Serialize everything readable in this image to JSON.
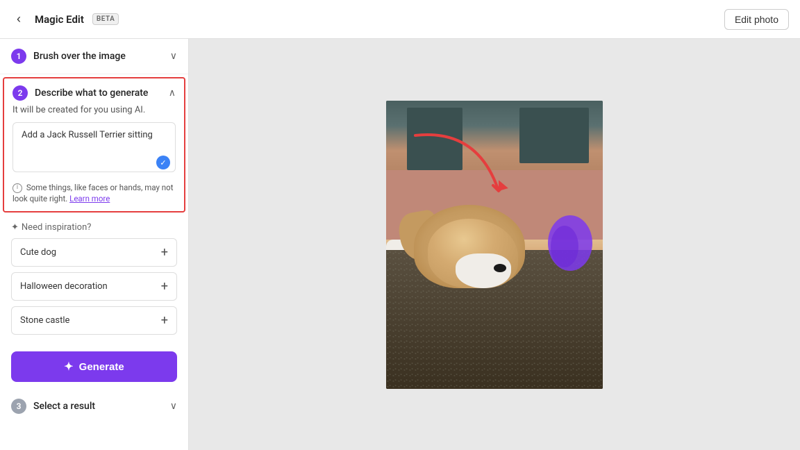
{
  "header": {
    "back_label": "‹",
    "title": "Magic Edit",
    "beta_label": "BETA",
    "edit_photo_btn": "Edit photo"
  },
  "sidebar": {
    "step1": {
      "number": "1",
      "label": "Brush over the image",
      "chevron": "∨"
    },
    "step2": {
      "number": "2",
      "label": "Describe what to generate",
      "subtitle": "It will be created for you using AI.",
      "prompt_value": "Add a Jack Russell Terrier sitting",
      "prompt_placeholder": "Add a Jack Russell Terrier sitting",
      "warning_main": "Some things, like faces or hands, may not look quite right.",
      "warning_link": "Learn more",
      "chevron": "∧"
    },
    "inspiration": {
      "label": "Need inspiration?",
      "suggestions": [
        {
          "label": "Cute dog"
        },
        {
          "label": "Halloween decoration"
        },
        {
          "label": "Stone castle"
        }
      ]
    },
    "generate_btn": "Generate",
    "step3": {
      "number": "3",
      "label": "Select a result",
      "chevron": "∨"
    }
  }
}
